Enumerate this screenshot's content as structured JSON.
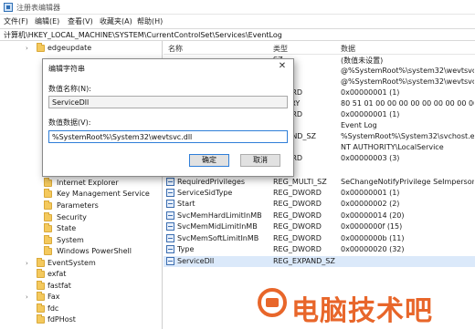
{
  "window": {
    "title": "注册表编辑器"
  },
  "menu": {
    "file": "文件(F)",
    "edit": "编辑(E)",
    "view": "查看(V)",
    "favorites": "收藏夹(A)",
    "help": "帮助(H)"
  },
  "address": {
    "path": "计算机\\HKEY_LOCAL_MACHINE\\SYSTEM\\CurrentControlSet\\Services\\EventLog"
  },
  "tree": {
    "items": [
      {
        "label": "edgeupdate",
        "expander": "›"
      },
      {
        "label": "Internet Explorer",
        "expander": ""
      },
      {
        "label": "Key Management Service",
        "expander": ""
      },
      {
        "label": "Parameters",
        "expander": ""
      },
      {
        "label": "Security",
        "expander": ""
      },
      {
        "label": "State",
        "expander": ""
      },
      {
        "label": "System",
        "expander": ""
      },
      {
        "label": "Windows PowerShell",
        "expander": ""
      },
      {
        "label": "EventSystem",
        "expander": "›"
      },
      {
        "label": "exfat",
        "expander": ""
      },
      {
        "label": "fastfat",
        "expander": ""
      },
      {
        "label": "Fax",
        "expander": "›"
      },
      {
        "label": "fdc",
        "expander": ""
      },
      {
        "label": "fdPHost",
        "expander": ""
      }
    ]
  },
  "list": {
    "headers": {
      "name": "名称",
      "type": "类型",
      "data": "数据"
    },
    "rows": [
      {
        "name": "",
        "type": "SZ",
        "data": "(数值未设置)"
      },
      {
        "name": "",
        "type": "SZ",
        "data": "@%SystemRoot%\\system32\\wevtsvc.dll"
      },
      {
        "name": "",
        "type": "SZ",
        "data": "@%SystemRoot%\\system32\\wevtsvc.dll"
      },
      {
        "name": "",
        "type": "DWORD",
        "data": "0x00000001 (1)"
      },
      {
        "name": "",
        "type": "BINARY",
        "data": "80 51 01 00 00 00 00 00 00 00 00 00"
      },
      {
        "name": "",
        "type": "DWORD",
        "data": "0x00000001 (1)"
      },
      {
        "name": "",
        "type": "SZ",
        "data": "Event Log"
      },
      {
        "name": "",
        "type": "EXPAND_SZ",
        "data": "%SystemRoot%\\System32\\svchost.exe"
      },
      {
        "name": "",
        "type": "SZ",
        "data": "NT AUTHORITY\\LocalService"
      },
      {
        "name": "",
        "type": "DWORD",
        "data": "0x00000003 (3)"
      },
      {
        "name": "RequiredPrivileges",
        "type": "REG_MULTI_SZ",
        "data": "SeChangeNotifyPrivilege SeImpersonat"
      },
      {
        "name": "ServiceSidType",
        "type": "REG_DWORD",
        "data": "0x00000001 (1)"
      },
      {
        "name": "Start",
        "type": "REG_DWORD",
        "data": "0x00000002 (2)"
      },
      {
        "name": "SvcMemHardLimitInMB",
        "type": "REG_DWORD",
        "data": "0x00000014 (20)"
      },
      {
        "name": "SvcMemMidLimitInMB",
        "type": "REG_DWORD",
        "data": "0x0000000f (15)"
      },
      {
        "name": "SvcMemSoftLimitInMB",
        "type": "REG_DWORD",
        "data": "0x0000000b (11)"
      },
      {
        "name": "Type",
        "type": "REG_DWORD",
        "data": "0x00000020 (32)"
      },
      {
        "name": "ServiceDll",
        "type": "REG_EXPAND_SZ",
        "data": ""
      }
    ]
  },
  "dialog": {
    "title": "编辑字符串",
    "close": "✕",
    "name_label": "数值名称(N):",
    "name_value": "ServiceDll",
    "data_label": "数值数据(V):",
    "data_value": "%SystemRoot%\\System32\\wevtsvc.dll",
    "ok": "确定",
    "cancel": "取消"
  },
  "watermark": {
    "text": "电脑技术吧"
  },
  "colors": {
    "selection": "#dbe9fa",
    "folder": "#f4c95d",
    "watermark": "#e8662a",
    "accent": "#2f7ed8"
  }
}
